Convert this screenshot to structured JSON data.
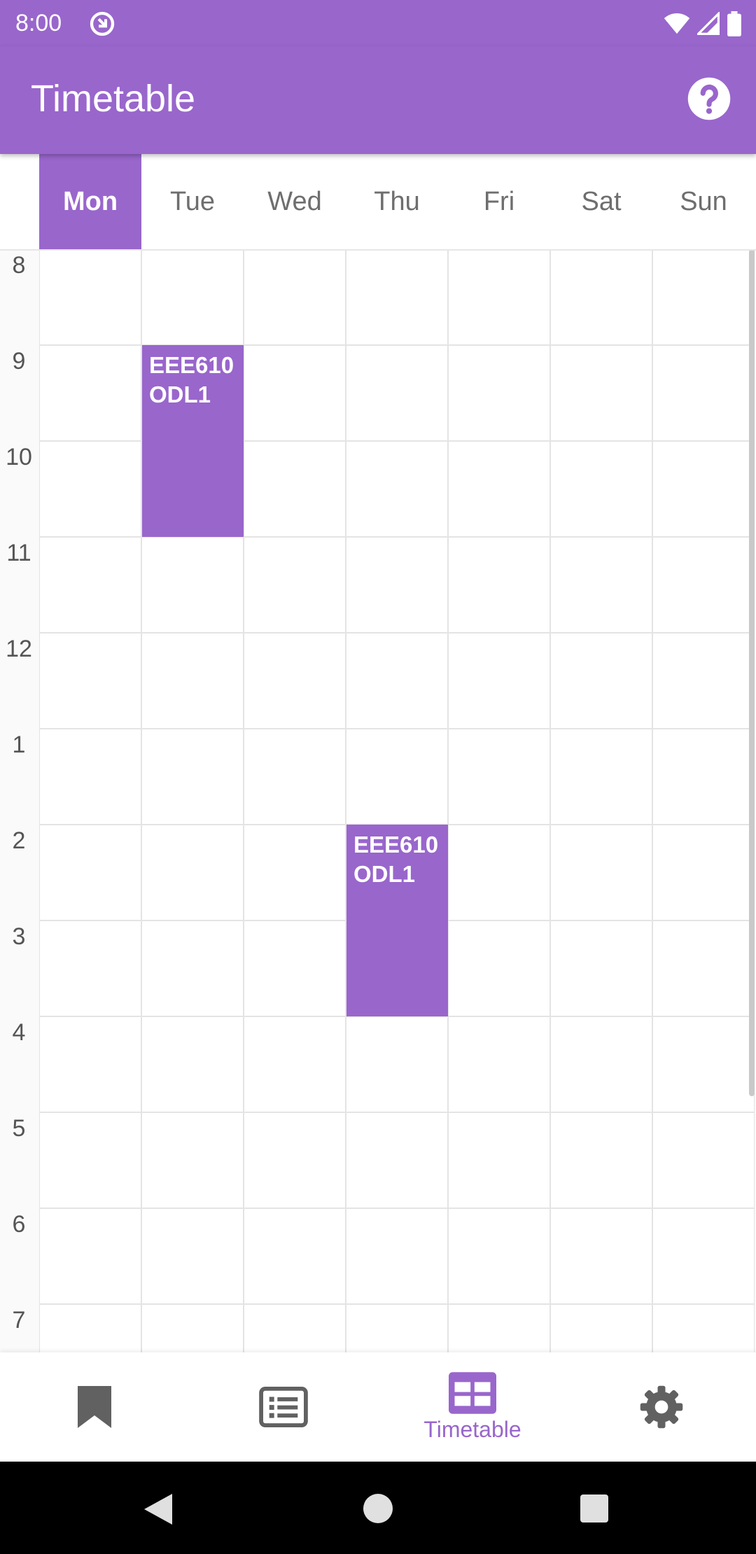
{
  "status_bar": {
    "time": "8:00",
    "icons": [
      "app-notification-icon",
      "wifi-icon",
      "cell-signal-icon",
      "battery-icon"
    ]
  },
  "app_bar": {
    "title": "Timetable",
    "help_icon": "help-icon"
  },
  "days": [
    {
      "label": "Mon",
      "active": true
    },
    {
      "label": "Tue",
      "active": false
    },
    {
      "label": "Wed",
      "active": false
    },
    {
      "label": "Thu",
      "active": false
    },
    {
      "label": "Fri",
      "active": false
    },
    {
      "label": "Sat",
      "active": false
    },
    {
      "label": "Sun",
      "active": false
    }
  ],
  "hours": [
    "8",
    "9",
    "10",
    "11",
    "12",
    "1",
    "2",
    "3",
    "4",
    "5",
    "6",
    "7"
  ],
  "events": [
    {
      "day": "Tue",
      "start_hour": "9",
      "end_hour": "11",
      "code": "EEE610",
      "group": "ODL1"
    },
    {
      "day": "Thu",
      "start_hour": "2",
      "end_hour": "4",
      "code": "EEE610",
      "group": "ODL1"
    }
  ],
  "bottom_nav": [
    {
      "icon": "bookmark-icon",
      "label": "",
      "active": false
    },
    {
      "icon": "list-icon",
      "label": "",
      "active": false
    },
    {
      "icon": "timetable-icon",
      "label": "Timetable",
      "active": true
    },
    {
      "icon": "settings-icon",
      "label": "",
      "active": false
    }
  ],
  "system_nav": [
    "back-icon",
    "home-icon",
    "recents-icon"
  ],
  "colors": {
    "accent": "#9966cc",
    "grid_line": "#e4e4e4",
    "inactive_icon": "#616161"
  }
}
